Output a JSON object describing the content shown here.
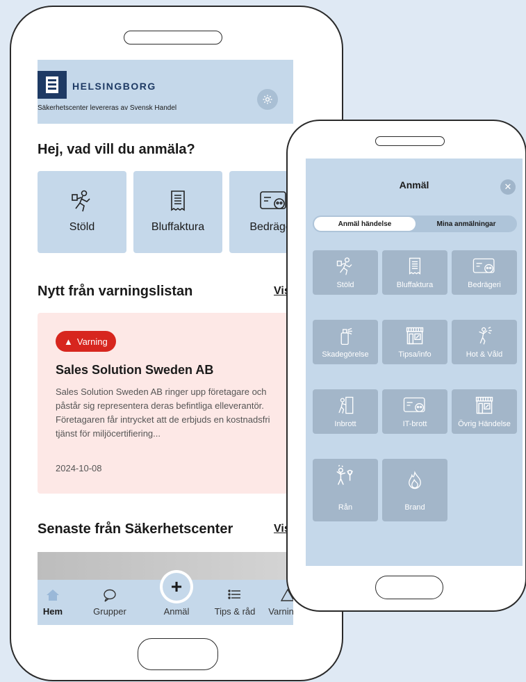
{
  "header": {
    "brand": "HELSINGBORG",
    "tagline": "Säkerhetscenter levereras av Svensk Handel"
  },
  "report": {
    "heading": "Hej, vad vill du anmäla?",
    "categories": [
      "Stöld",
      "Bluffaktura",
      "Bedrägeri"
    ]
  },
  "warnings": {
    "heading": "Nytt från varningslistan",
    "show_all": "Visa",
    "badge": "Varning",
    "title": "Sales Solution Sweden AB",
    "body": "Sales Solution Sweden AB ringer upp företagare och påstår sig representera deras befintliga elleverantör. Företagaren får intrycket att de erbjuds en kostnadsfri tjänst för miljöcertifiering...",
    "date": "2024-10-08"
  },
  "latest": {
    "heading": "Senaste från Säkerhetscenter",
    "show_all": "Visa"
  },
  "tabbar": {
    "items": [
      "Hem",
      "Grupper",
      "Anmäl",
      "Tips & råd",
      "Varningar"
    ],
    "active": "Hem"
  },
  "modal": {
    "title": "Anmäl",
    "segments": [
      "Anmäl händelse",
      "Mina anmälningar"
    ],
    "active_segment": "Anmäl händelse",
    "tiles": [
      "Stöld",
      "Bluffaktura",
      "Bedrägeri",
      "Skadegörelse",
      "Tipsa/info",
      "Hot & Våld",
      "Inbrott",
      "IT-brott",
      "Övrig Händelse",
      "Rån",
      "Brand"
    ]
  },
  "colors": {
    "accent": "#c5d8ea",
    "warning": "#d7261e",
    "navy": "#1e3a64"
  }
}
